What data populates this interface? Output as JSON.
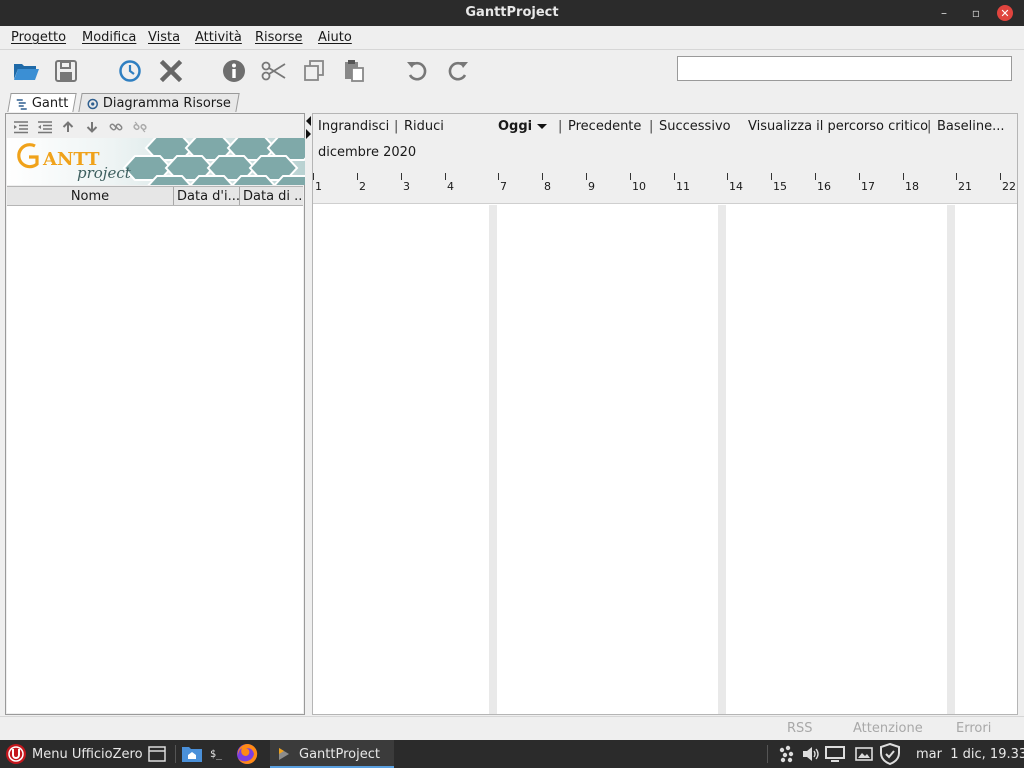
{
  "window": {
    "title": "GanttProject",
    "minimize_glyph": "–",
    "restore_glyph": "▫",
    "close_glyph": "✕"
  },
  "menu": [
    {
      "label": "Progetto"
    },
    {
      "label": "Modifica"
    },
    {
      "label": "Vista"
    },
    {
      "label": "Attività"
    },
    {
      "label": "Risorse"
    },
    {
      "label": "Aiuto"
    }
  ],
  "toolbar": {
    "icons": [
      "open-folder-icon",
      "save-icon",
      "clock-icon",
      "delete-icon",
      "info-icon",
      "cut-icon",
      "copy-icon",
      "paste-icon",
      "undo-icon",
      "redo-icon"
    ],
    "search_value": "",
    "accent": "#2f7fc1"
  },
  "tabs": [
    {
      "label": "Gantt",
      "active": true
    },
    {
      "label": "Diagramma Risorse",
      "active": false
    }
  ],
  "task_table": {
    "columns": [
      "Nome",
      "Data d'i...",
      "Data di ..."
    ],
    "rows": []
  },
  "chart_toolbar": {
    "zoom_in": "Ingrandisci",
    "zoom_out": "Riduci",
    "today": "Oggi",
    "previous": "Precedente",
    "next": "Successivo",
    "critical_path": "Visualizza il percorso critico",
    "baseline": "Baseline...",
    "separator": "|"
  },
  "timeline": {
    "month": "dicembre 2020",
    "days": [
      "1",
      "2",
      "3",
      "4",
      "7",
      "8",
      "9",
      "10",
      "11",
      "14",
      "15",
      "16",
      "17",
      "18",
      "21",
      "22"
    ]
  },
  "statusbar": {
    "rss": "RSS",
    "warnings": "Attenzione",
    "errors": "Errori"
  },
  "taskbar": {
    "menu_label": "Menu UfficioZero",
    "terminal_glyph": "$_",
    "active_window": "GanttProject",
    "clock": "mar  1 dic, 19.33"
  }
}
